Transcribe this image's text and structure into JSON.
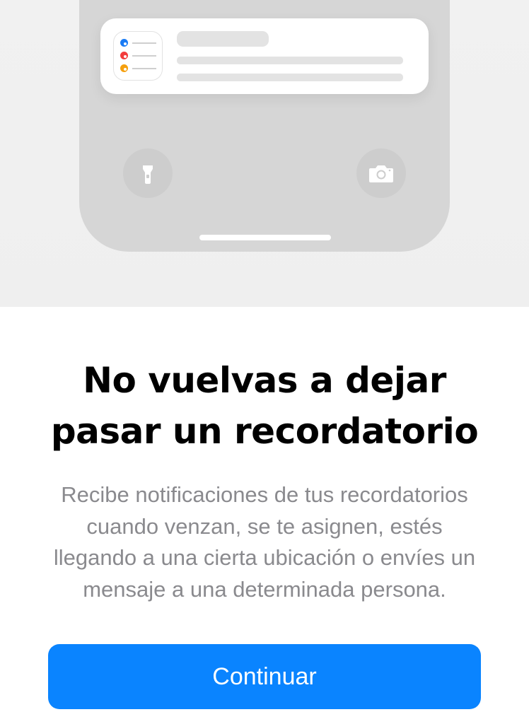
{
  "illustration": {
    "reminder_dot_colors": [
      "#1a7cf5",
      "#f23d3d",
      "#f5a00f"
    ],
    "left_button_icon": "flashlight-icon",
    "right_button_icon": "camera-icon"
  },
  "content": {
    "title_line1": "No vuelvas a dejar",
    "title_line2": "pasar un recordatorio",
    "description_lines": [
      "Recibe notificaciones de tus recordatorios",
      "cuando venzan, se te asignen, estés",
      "llegando a una cierta ubicación o envíes un",
      "mensaje a una determinada persona."
    ]
  },
  "actions": {
    "continue_label": "Continuar",
    "accent_color": "#0a84ff"
  }
}
